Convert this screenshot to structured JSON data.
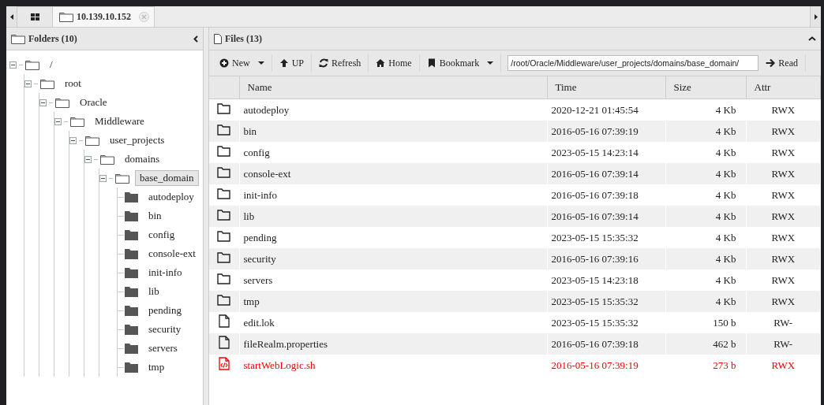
{
  "tabs": [
    {
      "kind": "grid",
      "selected": false
    },
    {
      "kind": "folder",
      "label": "10.139.10.152",
      "selected": true
    }
  ],
  "folders_panel": {
    "title": "Folders (10)",
    "tree": [
      {
        "label": "/",
        "selected": false,
        "children": [
          {
            "label": "root",
            "selected": false,
            "children": [
              {
                "label": "Oracle",
                "selected": false,
                "children": [
                  {
                    "label": "Middleware",
                    "selected": false,
                    "children": [
                      {
                        "label": "user_projects",
                        "selected": false,
                        "children": [
                          {
                            "label": "domains",
                            "selected": false,
                            "children": [
                              {
                                "label": "base_domain",
                                "selected": true,
                                "children": [
                                  {
                                    "label": "autodeploy",
                                    "selected": false
                                  },
                                  {
                                    "label": "bin",
                                    "selected": false
                                  },
                                  {
                                    "label": "config",
                                    "selected": false
                                  },
                                  {
                                    "label": "console-ext",
                                    "selected": false
                                  },
                                  {
                                    "label": "init-info",
                                    "selected": false
                                  },
                                  {
                                    "label": "lib",
                                    "selected": false
                                  },
                                  {
                                    "label": "pending",
                                    "selected": false
                                  },
                                  {
                                    "label": "security",
                                    "selected": false
                                  },
                                  {
                                    "label": "servers",
                                    "selected": false
                                  },
                                  {
                                    "label": "tmp",
                                    "selected": false
                                  }
                                ]
                              }
                            ]
                          }
                        ]
                      }
                    ]
                  }
                ]
              }
            ]
          }
        ]
      }
    ]
  },
  "files_panel": {
    "title": "Files (13)",
    "toolbar": [
      {
        "kind": "new",
        "label": "New",
        "dropdown": true
      },
      {
        "kind": "up",
        "label": "UP",
        "dropdown": false
      },
      {
        "kind": "refresh",
        "label": "Refresh",
        "dropdown": false
      },
      {
        "kind": "home",
        "label": "Home",
        "dropdown": false
      },
      {
        "kind": "bookmark",
        "label": "Bookmark",
        "dropdown": true
      }
    ],
    "path": "/root/Oracle/Middleware/user_projects/domains/base_domain/",
    "read_button": "Read",
    "columns": [
      "Name",
      "Time",
      "Size",
      "Attr"
    ],
    "rows": [
      {
        "kind": "folder",
        "name": "autodeploy",
        "time": "2020-12-21 01:45:54",
        "size": "4 Kb",
        "attr": "RWX"
      },
      {
        "kind": "folder",
        "name": "bin",
        "time": "2016-05-16 07:39:19",
        "size": "4 Kb",
        "attr": "RWX"
      },
      {
        "kind": "folder",
        "name": "config",
        "time": "2023-05-15 14:23:14",
        "size": "4 Kb",
        "attr": "RWX"
      },
      {
        "kind": "folder",
        "name": "console-ext",
        "time": "2016-05-16 07:39:14",
        "size": "4 Kb",
        "attr": "RWX"
      },
      {
        "kind": "folder",
        "name": "init-info",
        "time": "2016-05-16 07:39:18",
        "size": "4 Kb",
        "attr": "RWX"
      },
      {
        "kind": "folder",
        "name": "lib",
        "time": "2016-05-16 07:39:14",
        "size": "4 Kb",
        "attr": "RWX"
      },
      {
        "kind": "folder",
        "name": "pending",
        "time": "2023-05-15 15:35:32",
        "size": "4 Kb",
        "attr": "RWX"
      },
      {
        "kind": "folder",
        "name": "security",
        "time": "2016-05-16 07:39:16",
        "size": "4 Kb",
        "attr": "RWX"
      },
      {
        "kind": "folder",
        "name": "servers",
        "time": "2023-05-15 14:23:18",
        "size": "4 Kb",
        "attr": "RWX"
      },
      {
        "kind": "folder",
        "name": "tmp",
        "time": "2023-05-15 15:35:32",
        "size": "4 Kb",
        "attr": "RWX"
      },
      {
        "kind": "file",
        "name": "edit.lok",
        "time": "2023-05-15 15:35:32",
        "size": "150 b",
        "attr": "RW-"
      },
      {
        "kind": "file",
        "name": "fileRealm.properties",
        "time": "2016-05-16 07:39:18",
        "size": "462 b",
        "attr": "RW-"
      },
      {
        "kind": "script",
        "name": "startWebLogic.sh",
        "time": "2016-05-16 07:39:19",
        "size": "273 b",
        "attr": "RWX"
      }
    ]
  }
}
